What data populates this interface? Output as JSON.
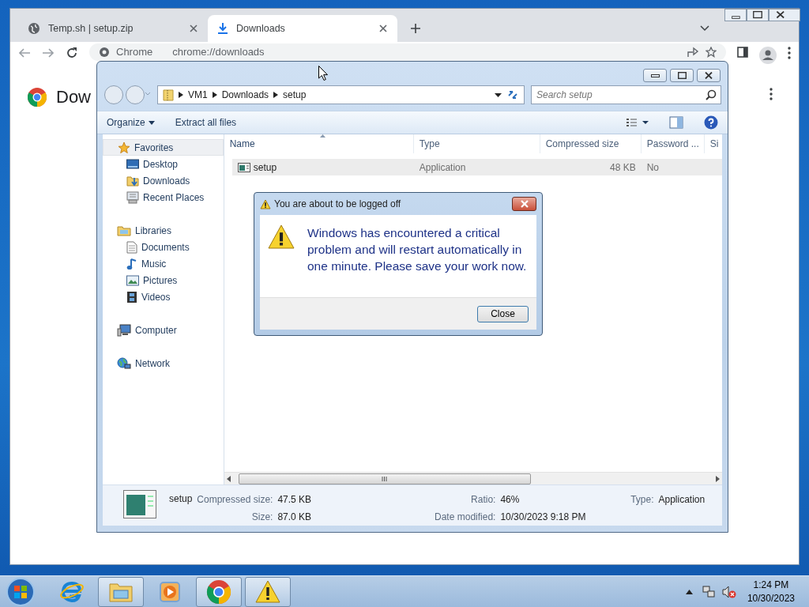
{
  "browser": {
    "tabs": [
      {
        "title": "Temp.sh | setup.zip",
        "selected": false
      },
      {
        "title": "Downloads",
        "selected": true
      }
    ],
    "address": {
      "label": "Chrome",
      "url": "chrome://downloads"
    },
    "page": {
      "heading": "Dow"
    }
  },
  "explorer": {
    "breadcrumbs": [
      "VM1",
      "Downloads",
      "setup"
    ],
    "search": {
      "placeholder": "Search setup"
    },
    "toolbar": [
      "Organize",
      "Extract all files"
    ],
    "sidebar": [
      {
        "label": "Favorites",
        "selected": true,
        "children": [
          "Desktop",
          "Downloads",
          "Recent Places"
        ]
      },
      {
        "label": "Libraries",
        "selected": false,
        "children": [
          "Documents",
          "Music",
          "Pictures",
          "Videos"
        ]
      },
      {
        "label": "Computer",
        "selected": false
      },
      {
        "label": "Network",
        "selected": false
      }
    ],
    "columns": [
      {
        "label": "Name",
        "sorted": true
      },
      {
        "label": "Type",
        "sorted": false
      },
      {
        "label": "Compressed size",
        "sorted": false
      },
      {
        "label": "Password ...",
        "sorted": false
      },
      {
        "label": "Si",
        "sorted": false
      }
    ],
    "rows": [
      {
        "name": "setup",
        "type": "Application",
        "compressed_size": "48 KB",
        "password": "No",
        "selected": true
      }
    ],
    "details": {
      "name": "setup",
      "fields": [
        {
          "label": "Compressed size:",
          "value": "47.5 KB"
        },
        {
          "label": "Ratio:",
          "value": "46%"
        },
        {
          "label": "Type:",
          "value": "Application"
        },
        {
          "label": "Size:",
          "value": "87.0 KB"
        },
        {
          "label": "Date modified:",
          "value": "10/30/2023 9:18 PM"
        }
      ]
    }
  },
  "dialog": {
    "title": "You are about to be logged off",
    "message": "Windows has encountered a critical problem and will restart automatically in one minute. Please save your work now.",
    "button": "Close"
  },
  "taskbar": {
    "buttons": [
      {
        "kind": "ie",
        "running": false
      },
      {
        "kind": "explorer",
        "running": true
      },
      {
        "kind": "media",
        "running": false
      },
      {
        "kind": "chrome",
        "running": true
      },
      {
        "kind": "warning",
        "running": true
      }
    ],
    "clock": {
      "time": "1:24 PM",
      "date": "10/30/2023"
    }
  }
}
